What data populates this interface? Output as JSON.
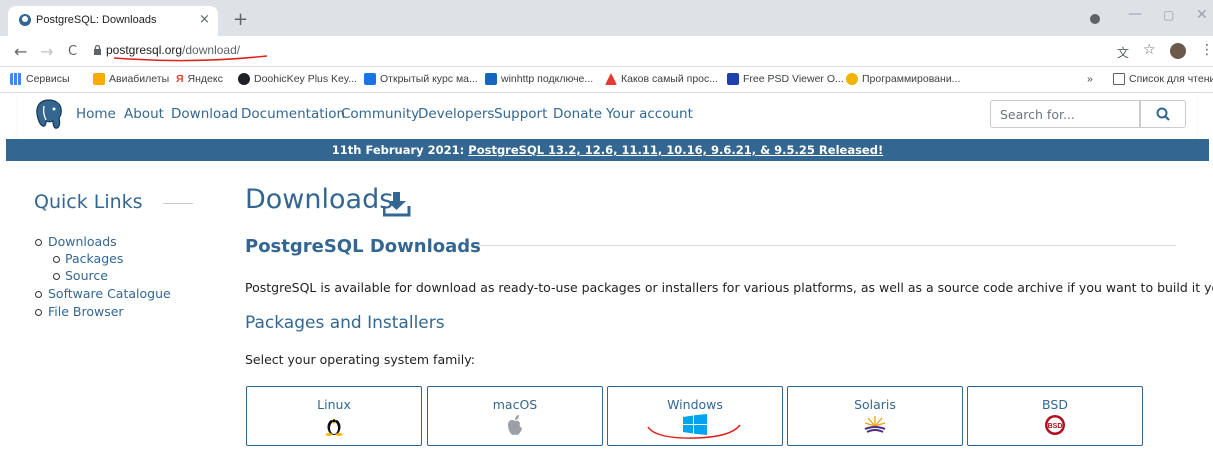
{
  "browser": {
    "tab_title": "PostgreSQL: Downloads",
    "tab_close": "×",
    "new_tab": "+",
    "url_host": "postgresql.org",
    "url_path": "/download/",
    "back": "←",
    "forward": "→",
    "reload": "C",
    "bookmarks": [
      {
        "label": "Сервисы",
        "color": "#4285f4"
      },
      {
        "label": "Авиабилеты",
        "color": "#f9ab00"
      },
      {
        "label": "Яндекс",
        "color": "#ea4335"
      },
      {
        "label": "DoohicKey Plus Key...",
        "color": "#202124"
      },
      {
        "label": "Открытый курс ма...",
        "color": "#1a73e8"
      },
      {
        "label": "winhttp подключе...",
        "color": "#1565c0"
      },
      {
        "label": "Каков самый прос...",
        "color": "#e53935"
      },
      {
        "label": "Free PSD Viewer O...",
        "color": "#1e40af"
      },
      {
        "label": "Программировани...",
        "color": "#5d4037"
      }
    ],
    "bookmarks_more": "»",
    "reading_list": "Список для чтения"
  },
  "site": {
    "nav": [
      "Home",
      "About",
      "Download",
      "Documentation",
      "Community",
      "Developers",
      "Support",
      "Donate",
      "Your account"
    ],
    "search_placeholder": "Search for...",
    "banner_prefix": "11th February 2021: ",
    "banner_link": "PostgreSQL 13.2, 12.6, 11.11, 10.16, 9.6.21, & 9.5.25 Released!",
    "brand_color": "#336791"
  },
  "sidebar": {
    "title": "Quick Links",
    "items": [
      {
        "label": "Downloads"
      },
      {
        "label": "Packages"
      },
      {
        "label": "Source"
      },
      {
        "label": "Software Catalogue"
      },
      {
        "label": "File Browser"
      }
    ]
  },
  "main": {
    "title": "Downloads",
    "subtitle": "PostgreSQL Downloads",
    "intro": "PostgreSQL is available for download as ready-to-use packages or installers for various platforms, as well as a source code archive if you want to build it yourself.",
    "packages_heading": "Packages and Installers",
    "select_prompt": "Select your operating system family:",
    "os": [
      {
        "label": "Linux",
        "icon": "linux-tux-icon"
      },
      {
        "label": "macOS",
        "icon": "apple-icon"
      },
      {
        "label": "Windows",
        "icon": "windows-icon"
      },
      {
        "label": "Solaris",
        "icon": "solaris-icon"
      },
      {
        "label": "BSD",
        "icon": "bsd-icon"
      }
    ]
  }
}
